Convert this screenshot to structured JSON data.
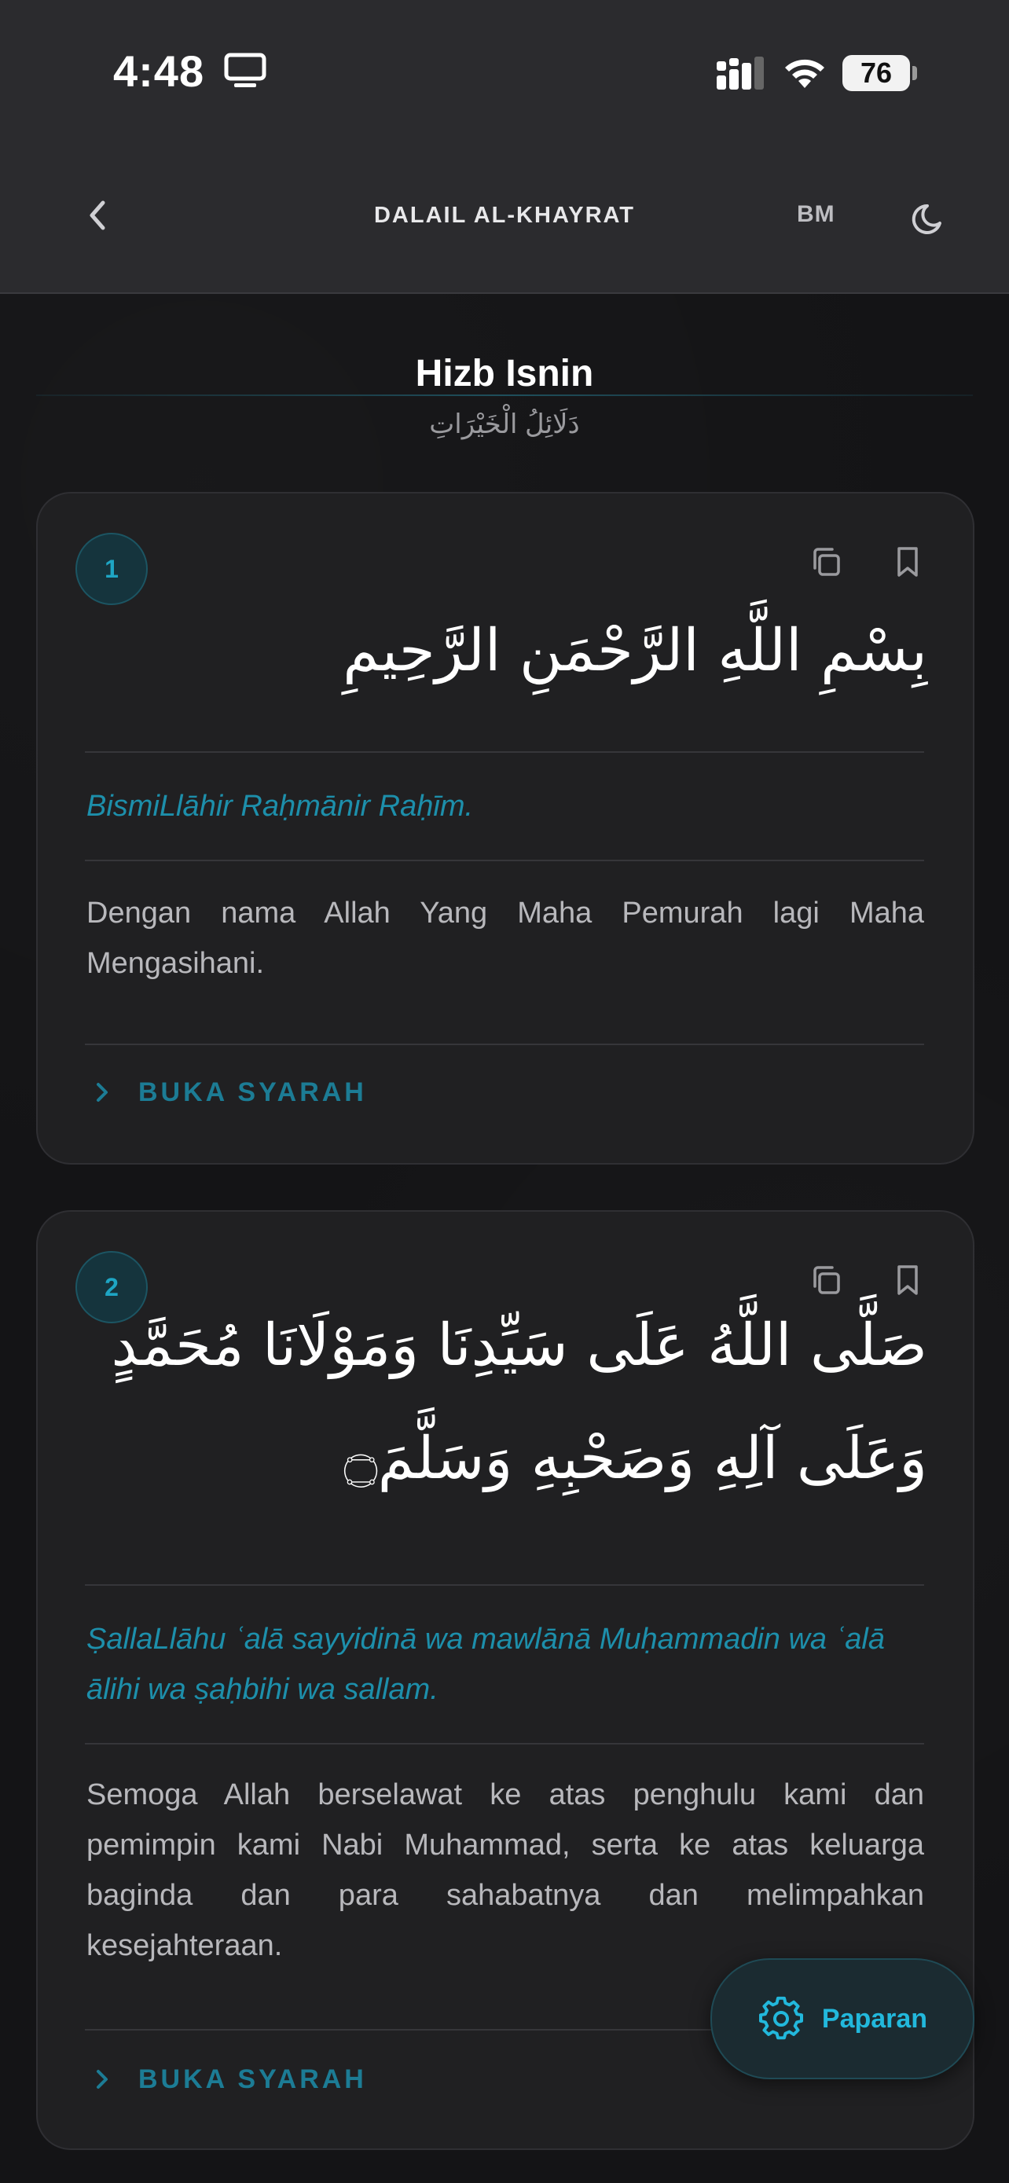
{
  "status_bar": {
    "time": "4:48",
    "battery": "76",
    "icons": [
      "monitor-icon",
      "signal-icon",
      "wifi-icon",
      "battery-icon"
    ]
  },
  "header": {
    "title": "DALAIL AL-KHAYRAT",
    "lang_label": "BM",
    "icons": [
      "back-chevron-icon",
      "moon-icon"
    ]
  },
  "page": {
    "title": "Hizb Isnin",
    "subtitle": "دَلَائِلُ الْخَيْرَاتِ"
  },
  "cards": [
    {
      "number": "1",
      "arabic": "بِسْمِ اللَّهِ الرَّحْمَنِ الرَّحِيمِ",
      "transliteration": "BismiLlāhir Raḥmānir Raḥīm.",
      "translation": "Dengan nama Allah Yang Maha Pemurah lagi Maha Mengasihani.",
      "syarah_label": "BUKA SYARAH"
    },
    {
      "number": "2",
      "arabic": "صَلَّى اللَّهُ عَلَى سَيِّدِنَا وَمَوْلَانَا مُحَمَّدٍ وَعَلَى آلِهِ وَصَحْبِهِ وَسَلَّمَ۝",
      "transliteration": "ṢallaLlāhu ʿalā sayyidinā wa mawlānā Muḥammadin wa ʿalā ālihi wa ṣaḥbihi wa sallam.",
      "translation": "Semoga Allah berselawat ke atas penghulu kami dan pemimpin kami Nabi Muhammad, serta ke atas keluarga baginda dan para sahabatnya dan melimpahkan kesejahteraan.",
      "syarah_label": "BUKA SYARAH"
    }
  ],
  "fab": {
    "label": "Paparan",
    "icon": "gear-icon"
  },
  "colors": {
    "accent": "#1ea5c4",
    "background": "#141416",
    "card": "#202022",
    "topbar": "#2b2b2e"
  }
}
